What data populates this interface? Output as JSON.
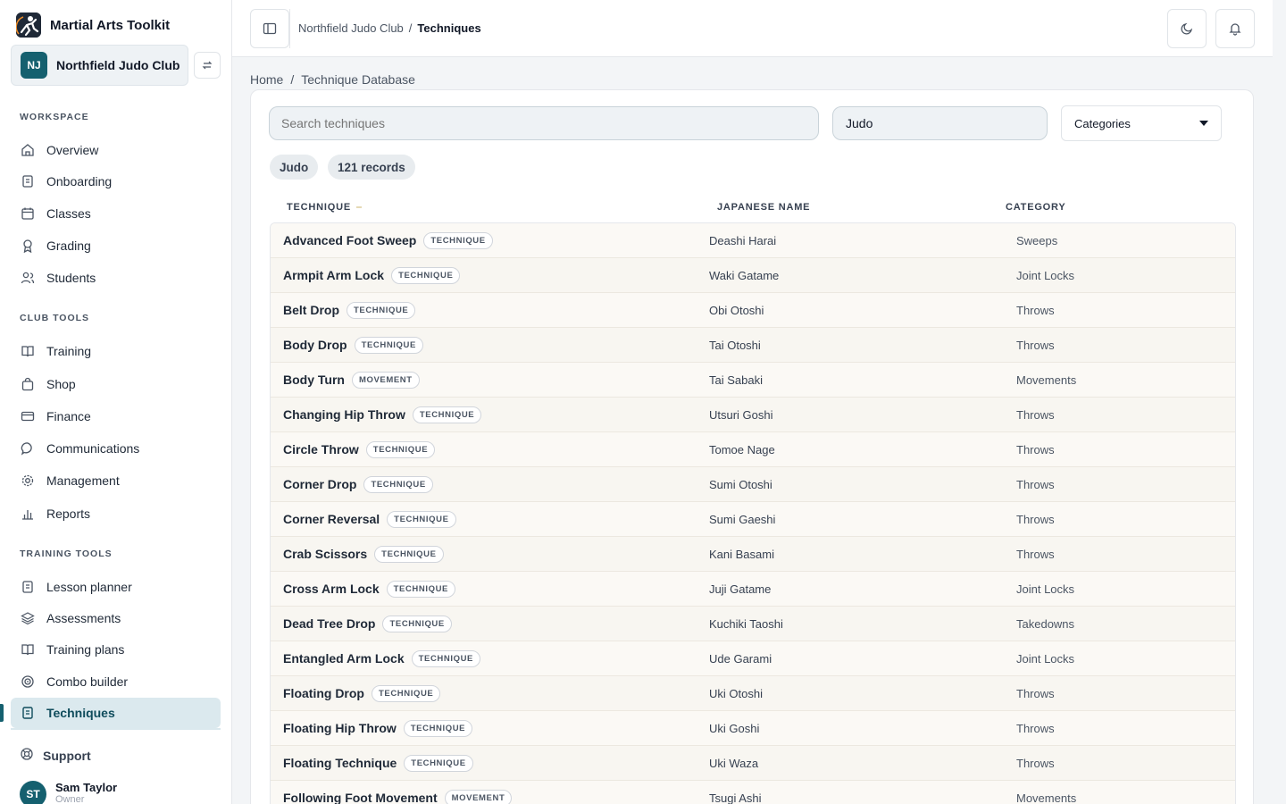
{
  "brand": {
    "title": "Martial Arts Toolkit"
  },
  "club": {
    "initials": "NJ",
    "name": "Northfield Judo Club"
  },
  "sidebar": {
    "workspace_label": "WORKSPACE",
    "workspace": [
      {
        "label": "Overview",
        "icon": "home-icon"
      },
      {
        "label": "Onboarding",
        "icon": "clipboard-icon"
      },
      {
        "label": "Classes",
        "icon": "calendar-icon"
      },
      {
        "label": "Grading",
        "icon": "award-icon"
      },
      {
        "label": "Students",
        "icon": "users-icon"
      }
    ],
    "club_tools_label": "CLUB TOOLS",
    "club_tools": [
      {
        "label": "Training",
        "icon": "book-icon"
      },
      {
        "label": "Shop",
        "icon": "bag-icon"
      },
      {
        "label": "Finance",
        "icon": "card-icon"
      },
      {
        "label": "Communications",
        "icon": "chat-icon"
      },
      {
        "label": "Management",
        "icon": "gear-icon"
      },
      {
        "label": "Reports",
        "icon": "bar-chart-icon"
      }
    ],
    "training_tools_label": "TRAINING TOOLS",
    "training_tools": [
      {
        "label": "Lesson planner",
        "icon": "clipboard-icon"
      },
      {
        "label": "Assessments",
        "icon": "layers-icon"
      },
      {
        "label": "Training plans",
        "icon": "book-icon"
      },
      {
        "label": "Combo builder",
        "icon": "target-icon"
      },
      {
        "label": "Techniques",
        "icon": "document-icon"
      }
    ],
    "support_label": "Support",
    "user": {
      "initials": "ST",
      "name": "Sam Taylor",
      "role": "Owner"
    }
  },
  "topbar": {
    "club": "Northfield Judo Club",
    "separator": "/",
    "current": "Techniques"
  },
  "breadcrumb": {
    "home": "Home",
    "separator": "/",
    "current": "Technique Database"
  },
  "filters": {
    "search_placeholder": "Search techniques",
    "art_value": "Judo",
    "category_value": "Categories",
    "chip_art": "Judo",
    "chip_records": "121 records"
  },
  "table": {
    "headers": {
      "technique": "TECHNIQUE",
      "japanese": "JAPANESE NAME",
      "category": "CATEGORY"
    },
    "rows": [
      {
        "name": "Advanced Foot Sweep",
        "badge": "TECHNIQUE",
        "japanese": "Deashi Harai",
        "category": "Sweeps"
      },
      {
        "name": "Armpit Arm Lock",
        "badge": "TECHNIQUE",
        "japanese": "Waki Gatame",
        "category": "Joint Locks"
      },
      {
        "name": "Belt Drop",
        "badge": "TECHNIQUE",
        "japanese": "Obi Otoshi",
        "category": "Throws"
      },
      {
        "name": "Body Drop",
        "badge": "TECHNIQUE",
        "japanese": "Tai Otoshi",
        "category": "Throws"
      },
      {
        "name": "Body Turn",
        "badge": "MOVEMENT",
        "japanese": "Tai Sabaki",
        "category": "Movements"
      },
      {
        "name": "Changing Hip Throw",
        "badge": "TECHNIQUE",
        "japanese": "Utsuri Goshi",
        "category": "Throws"
      },
      {
        "name": "Circle Throw",
        "badge": "TECHNIQUE",
        "japanese": "Tomoe Nage",
        "category": "Throws"
      },
      {
        "name": "Corner Drop",
        "badge": "TECHNIQUE",
        "japanese": "Sumi Otoshi",
        "category": "Throws"
      },
      {
        "name": "Corner Reversal",
        "badge": "TECHNIQUE",
        "japanese": "Sumi Gaeshi",
        "category": "Throws"
      },
      {
        "name": "Crab Scissors",
        "badge": "TECHNIQUE",
        "japanese": "Kani Basami",
        "category": "Throws"
      },
      {
        "name": "Cross Arm Lock",
        "badge": "TECHNIQUE",
        "japanese": "Juji Gatame",
        "category": "Joint Locks"
      },
      {
        "name": "Dead Tree Drop",
        "badge": "TECHNIQUE",
        "japanese": "Kuchiki Taoshi",
        "category": "Takedowns"
      },
      {
        "name": "Entangled Arm Lock",
        "badge": "TECHNIQUE",
        "japanese": "Ude Garami",
        "category": "Joint Locks"
      },
      {
        "name": "Floating Drop",
        "badge": "TECHNIQUE",
        "japanese": "Uki Otoshi",
        "category": "Throws"
      },
      {
        "name": "Floating Hip Throw",
        "badge": "TECHNIQUE",
        "japanese": "Uki Goshi",
        "category": "Throws"
      },
      {
        "name": "Floating Technique",
        "badge": "TECHNIQUE",
        "japanese": "Uki Waza",
        "category": "Throws"
      },
      {
        "name": "Following Foot Movement",
        "badge": "MOVEMENT",
        "japanese": "Tsugi Ashi",
        "category": "Movements"
      }
    ]
  }
}
